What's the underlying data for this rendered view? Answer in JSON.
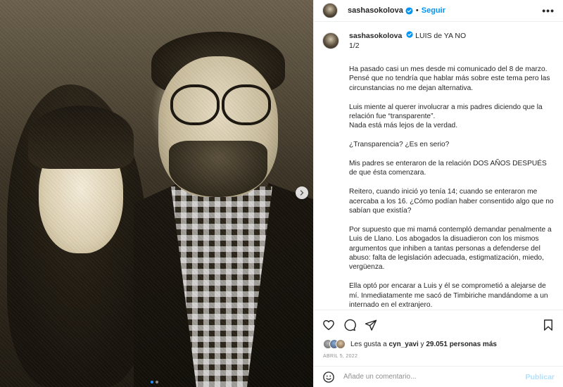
{
  "post": {
    "username": "sashasokolova",
    "follow_label": "Seguir",
    "separator": "•",
    "more_label": "•••"
  },
  "caption": {
    "username": "sashasokolova",
    "title": "LUIS de YA NO",
    "page_indicator": "1/2",
    "paragraphs": [
      "Ha pasado casi un mes desde mi comunicado del 8 de marzo.\nPensé que no tendría que hablar más sobre este tema pero las circunstancias no me dejan alternativa.",
      "Luis miente al querer involucrar a mis padres diciendo que la relación fue “transparente”.\nNada está más lejos de la verdad.",
      "¿Transparencia? ¿Es en serio?",
      "Mis padres se enteraron de la relación DOS AÑOS DESPUÉS de que ésta comenzara.",
      "Reitero, cuando inició yo tenía 14; cuando se enteraron me acercaba a los 16. ¿Cómo podían haber consentido algo que no sabían que existía?",
      "Por supuesto que mi mamá contempló demandar penalmente a Luis de Llano. Los abogados la disuadieron con los mismos argumentos que inhiben a tantas personas a defenderse del abuso: falta de legislación adecuada, estigmatización, miedo, vergüenza.",
      "Ella optó por encarar a Luis y él se comprometió a alejarse de mí. Inmediatamente me sacó de Timbiriche mandándome a un internado en el extranjero."
    ]
  },
  "likes": {
    "prefix": "Les gusta a",
    "user": "cyn_yavi",
    "connector": "y",
    "count_text": "29.051 personas más"
  },
  "date": "ABRIL 5, 2022",
  "comment": {
    "placeholder": "Añade un comentario...",
    "publish_label": "Publicar"
  },
  "carousel": {
    "current": 1,
    "total": 2
  },
  "colors": {
    "accent": "#0095f6",
    "publish_disabled": "#b2dffc",
    "text": "#262626",
    "muted": "#8e8e8e"
  },
  "icons": [
    "verified-badge-icon",
    "heart-icon",
    "comment-icon",
    "share-icon",
    "bookmark-icon",
    "emoji-icon",
    "chevron-right-icon"
  ]
}
